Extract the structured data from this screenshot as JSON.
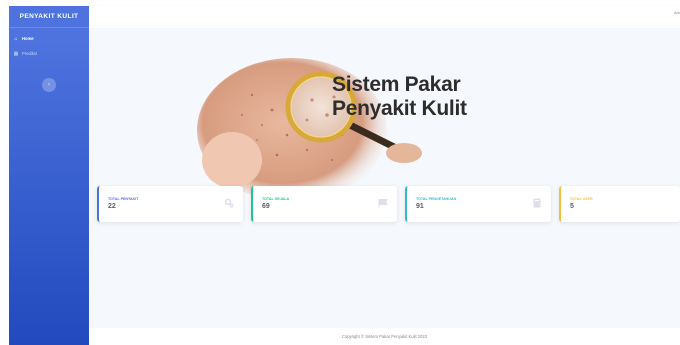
{
  "sidebar": {
    "brand": "PENYAKIT KULIT",
    "items": [
      {
        "label": "Home",
        "active": true
      },
      {
        "label": "Prediksi",
        "active": false
      }
    ],
    "toggle_glyph": "‹"
  },
  "topbar": {
    "user_text": "Admin"
  },
  "hero": {
    "title_line1": "Sistem Pakar",
    "title_line2": "Penyakit Kulit"
  },
  "cards": [
    {
      "label": "TOTAL PENYAKIT",
      "value": "22",
      "color": "#4e73df",
      "icon": "cogs-icon"
    },
    {
      "label": "TOTAL GEJALA",
      "value": "69",
      "color": "#1cc88a",
      "icon": "flag-icon"
    },
    {
      "label": "TOTAL PENGETAHUAN",
      "value": "91",
      "color": "#36b9cc",
      "icon": "book-icon"
    },
    {
      "label": "TOTAL USER",
      "value": "5",
      "color": "#f6c23e",
      "icon": "users-icon"
    }
  ],
  "footer": {
    "text": "Copyright © Sistem Pakar Penyakit Kulit 2023"
  }
}
